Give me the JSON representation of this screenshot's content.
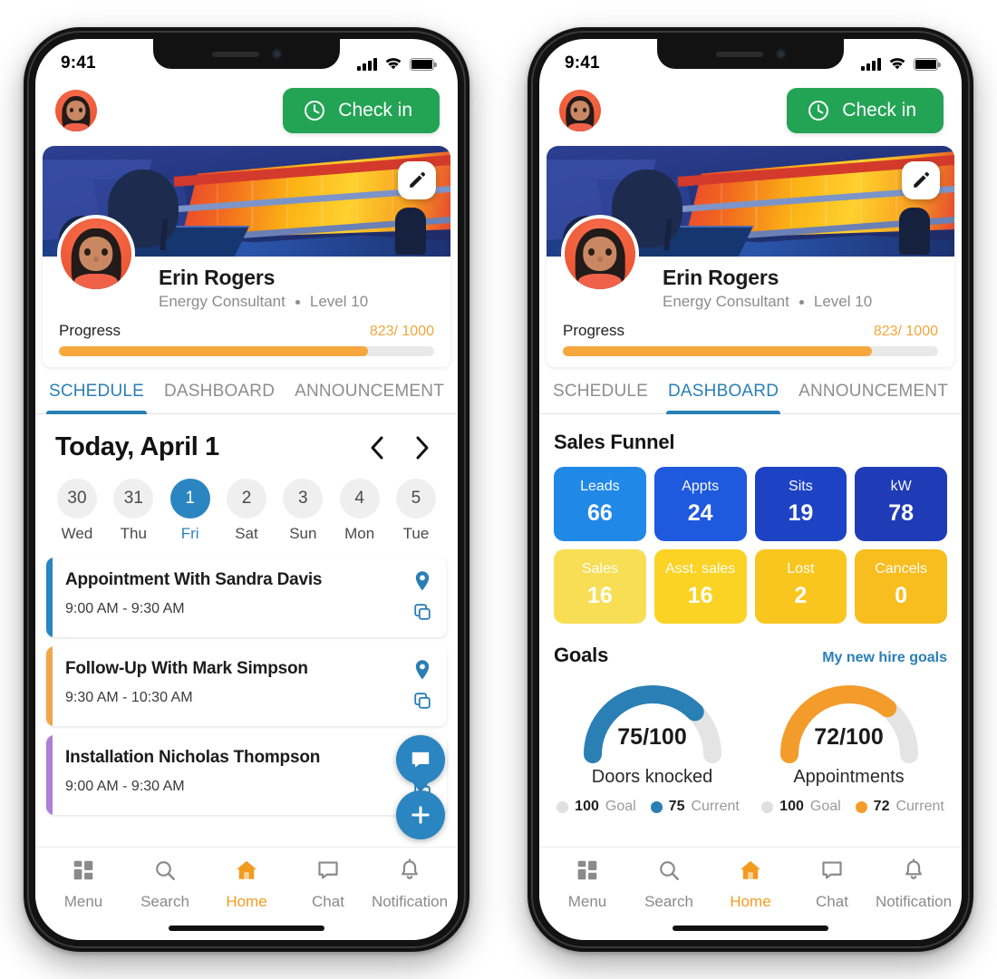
{
  "status_bar": {
    "time": "9:41",
    "signal_icon": "cellular-signal-icon",
    "wifi_icon": "wifi-icon",
    "battery_icon": "battery-icon"
  },
  "header": {
    "avatar_name": "user-avatar",
    "check_in_label": "Check in",
    "check_in_icon": "clock-icon",
    "check_in_color": "#23a455"
  },
  "profile": {
    "edit_icon": "pencil-icon",
    "name": "Erin Rogers",
    "role": "Energy Consultant",
    "level": "Level 10",
    "progress_label": "Progress",
    "progress_value": "823/ 1000",
    "progress_current": 823,
    "progress_total": 1000,
    "progress_color": "#f6a83f"
  },
  "tabs": [
    {
      "label": "SCHEDULE"
    },
    {
      "label": "DASHBOARD"
    },
    {
      "label": "ANNOUNCEMENT"
    }
  ],
  "tabs_active_left": "SCHEDULE",
  "tabs_active_right": "DASHBOARD",
  "tab_active_color": "#2a7fb5",
  "schedule": {
    "title": "Today,  April 1",
    "prev_icon": "chevron-left-icon",
    "next_icon": "chevron-right-icon",
    "dates": [
      {
        "num": "30",
        "dow": "Wed",
        "active": false
      },
      {
        "num": "31",
        "dow": "Thu",
        "active": false
      },
      {
        "num": "1",
        "dow": "Fri",
        "active": true
      },
      {
        "num": "2",
        "dow": "Sat",
        "active": false
      },
      {
        "num": "3",
        "dow": "Sun",
        "active": false
      },
      {
        "num": "4",
        "dow": "Mon",
        "active": false
      },
      {
        "num": "5",
        "dow": "Tue",
        "active": false
      }
    ],
    "appointments": [
      {
        "title": "Appointment With Sandra Davis",
        "time": "9:00 AM - 9:30 AM",
        "stripe": "#2a85c0",
        "pin_icon": "location-pin-icon",
        "copy_icon": "copy-icon"
      },
      {
        "title": "Follow-Up With Mark Simpson",
        "time": "9:30  AM - 10:30 AM",
        "stripe": "#f0a64a",
        "pin_icon": "location-pin-icon",
        "copy_icon": "copy-icon"
      },
      {
        "title": "Installation Nicholas Thompson",
        "time": "9:00 AM - 9:30 AM",
        "stripe": "#ad7fd6",
        "pin_icon": "location-pin-icon",
        "copy_icon": "copy-icon"
      }
    ],
    "fab_chat_icon": "chat-bubble-icon",
    "fab_add_icon": "plus-icon",
    "fab_color": "#2a85c0"
  },
  "dashboard": {
    "funnel_title": "Sales Funnel",
    "funnel_tiles": [
      {
        "label": "Leads",
        "value": "66",
        "color": "#2089e8"
      },
      {
        "label": "Appts",
        "value": "24",
        "color": "#1f59dd"
      },
      {
        "label": "Sits",
        "value": "19",
        "color": "#1e42c4"
      },
      {
        "label": "kW",
        "value": "78",
        "color": "#1f3bb5"
      },
      {
        "label": "Sales",
        "value": "16",
        "color": "#f7de55"
      },
      {
        "label": "Asst. sales",
        "value": "16",
        "color": "#fad324"
      },
      {
        "label": "Lost",
        "value": "2",
        "color": "#f9c620"
      },
      {
        "label": "Cancels",
        "value": "0",
        "color": "#f8be20"
      }
    ],
    "goals_title": "Goals",
    "goals_link": "My new hire goals",
    "gauges": [
      {
        "value_text": "75/100",
        "label": "Doors knocked",
        "current": 75,
        "goal": 100,
        "color": "#2a7fb5",
        "track_color": "#e4e4e4",
        "legend": [
          {
            "value": "100",
            "text": "Goal",
            "color": "#e0e0e0"
          },
          {
            "value": "75",
            "text": "Current",
            "color": "#2a7fb5"
          }
        ]
      },
      {
        "value_text": "72/100",
        "label": "Appointments",
        "current": 72,
        "goal": 100,
        "color": "#f39c2c",
        "track_color": "#e4e4e4",
        "legend": [
          {
            "value": "100",
            "text": "Goal",
            "color": "#e0e0e0"
          },
          {
            "value": "72",
            "text": "Current",
            "color": "#f39c2c"
          }
        ]
      }
    ]
  },
  "bottom_nav": {
    "active_color": "#f29b21",
    "items": [
      {
        "label": "Menu",
        "icon": "grid-menu-icon",
        "active": false
      },
      {
        "label": "Search",
        "icon": "search-icon",
        "active": false
      },
      {
        "label": "Home",
        "icon": "home-icon",
        "active": true
      },
      {
        "label": "Chat",
        "icon": "chat-icon",
        "active": false
      },
      {
        "label": "Notification",
        "icon": "bell-icon",
        "active": false
      }
    ]
  }
}
